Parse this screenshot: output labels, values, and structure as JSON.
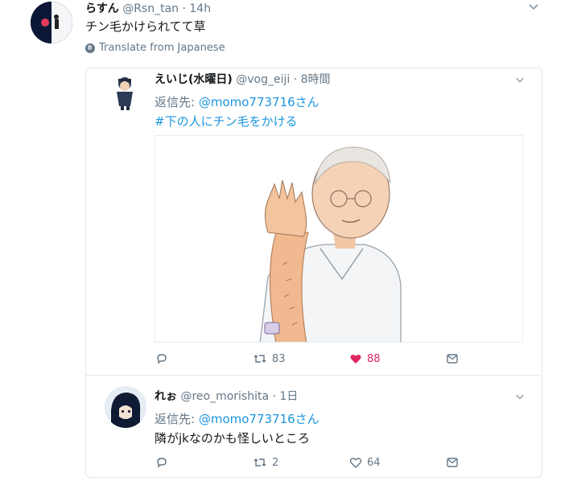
{
  "main_tweet": {
    "name": "らすん",
    "handle": "@Rsn_tan",
    "time": "· 14h",
    "text": "チン毛かけられてて草",
    "translate": "Translate from Japanese"
  },
  "quoted_tweet": {
    "name": "えいじ(水曜日)",
    "handle": "@vog_eiji",
    "time": "· 8時間",
    "reply_label": "返信先: ",
    "reply_to": "@momo773716さん",
    "hashtag": "#下の人にチン毛をかける",
    "retweets": "83",
    "likes": "88",
    "like_color": "#e0245e"
  },
  "reply_tweet": {
    "name": "れぉ",
    "handle": "@reo_morishita",
    "time": "· 1日",
    "reply_label": "返信先: ",
    "reply_to": "@momo773716さん",
    "text": "隣がjkなのかも怪しいところ",
    "retweets": "2",
    "likes": "64"
  },
  "icons": {
    "chevron": "chevron-down-icon",
    "reply": "reply-icon",
    "retweet": "retweet-icon",
    "like": "heart-icon",
    "dm": "message-icon",
    "globe": "globe-icon"
  },
  "colors": {
    "link": "#1b95e0",
    "muted": "#657786",
    "border": "#e1e8ed"
  }
}
